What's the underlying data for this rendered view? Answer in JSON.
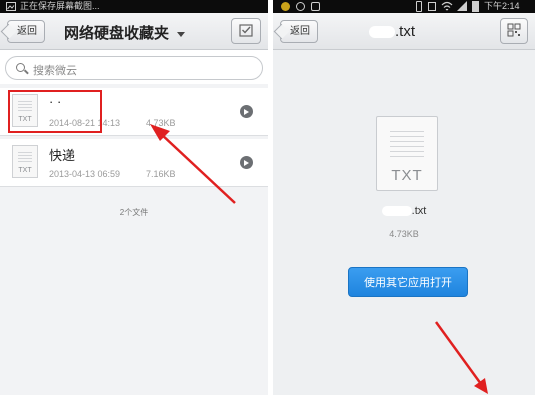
{
  "left_screen": {
    "status_text": "正在保存屏幕截图...",
    "back_label": "返回",
    "title": "网络硬盘收藏夹",
    "search_placeholder": "搜索微云",
    "files": [
      {
        "name": "·  ·",
        "date": "2014-08-21 14:13",
        "size": "4.73KB",
        "type": "TXT"
      },
      {
        "name": "快递",
        "date": "2013-04-13 06:59",
        "size": "7.16KB",
        "type": "TXT"
      }
    ],
    "file_count": "2个文件"
  },
  "right_screen": {
    "time": "下午2:14",
    "back_label": "返回",
    "title": ".txt",
    "file_type": "TXT",
    "file_name": ".txt",
    "file_size": "4.73KB",
    "open_button": "使用其它应用打开"
  },
  "colors": {
    "highlight_box": "#e02020",
    "arrow": "#e02020",
    "accent_button": "#2a8ee6"
  }
}
